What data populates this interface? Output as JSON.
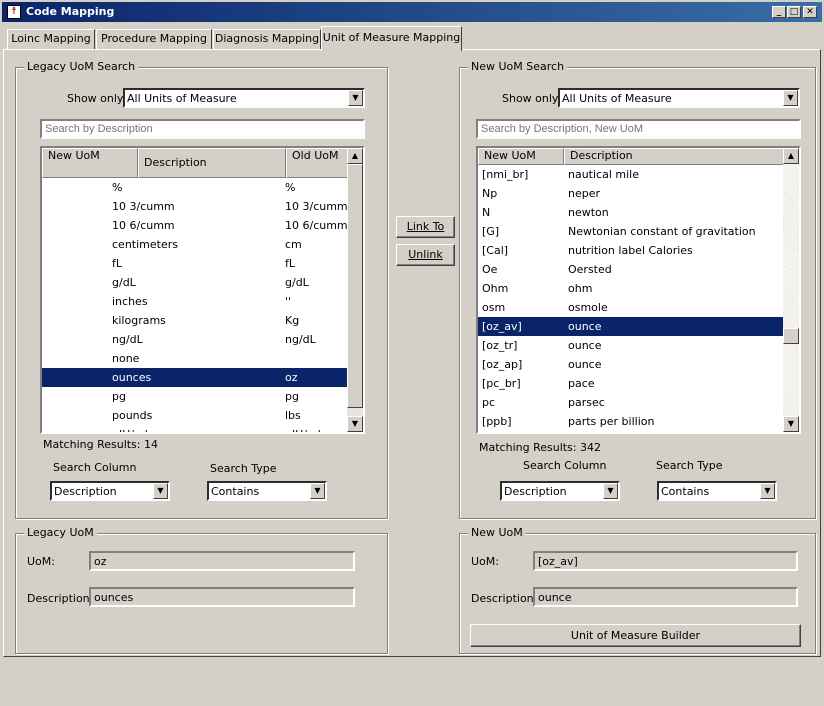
{
  "window": {
    "title": "Code Mapping"
  },
  "tabs": [
    {
      "label": "Loinc Mapping"
    },
    {
      "label": "Procedure  Mapping"
    },
    {
      "label": "Diagnosis Mapping"
    },
    {
      "label": "Unit of Measure Mapping",
      "active": true
    }
  ],
  "legacy_search": {
    "title": "Legacy UoM Search",
    "show_only_label": "Show only:",
    "show_only_value": "All Units of Measure",
    "search_placeholder": "Search by Description",
    "columns": [
      "New UoM",
      "Description",
      "Old UoM"
    ],
    "rows": [
      {
        "new": "",
        "desc": "%",
        "old": "%"
      },
      {
        "new": "",
        "desc": "10 3/cumm",
        "old": "10 3/cumm"
      },
      {
        "new": "",
        "desc": "10 6/cumm",
        "old": "10 6/cumm"
      },
      {
        "new": "",
        "desc": "centimeters",
        "old": "cm"
      },
      {
        "new": "",
        "desc": "fL",
        "old": "fL"
      },
      {
        "new": "",
        "desc": "g/dL",
        "old": "g/dL"
      },
      {
        "new": "",
        "desc": "inches",
        "old": "''"
      },
      {
        "new": "",
        "desc": "kilograms",
        "old": "Kg"
      },
      {
        "new": "",
        "desc": "ng/dL",
        "old": "ng/dL"
      },
      {
        "new": "",
        "desc": "none",
        "old": ""
      },
      {
        "new": "",
        "desc": "ounces",
        "old": "oz",
        "selected": true
      },
      {
        "new": "",
        "desc": "pg",
        "old": "pg"
      },
      {
        "new": "",
        "desc": "pounds",
        "old": "lbs"
      },
      {
        "new": "",
        "desc": "uIU/ml",
        "old": "uIU/ml"
      }
    ],
    "matching_results": "Matching Results: 14",
    "search_column_label": "Search Column",
    "search_column_value": "Description",
    "search_type_label": "Search Type",
    "search_type_value": "Contains"
  },
  "new_search": {
    "title": "New UoM Search",
    "show_only_label": "Show only:",
    "show_only_value": "All Units of Measure",
    "search_placeholder": "Search by Description, New UoM",
    "columns": [
      "New UoM",
      "Description"
    ],
    "rows": [
      {
        "uom": "[nmi_br]",
        "desc": "nautical mile"
      },
      {
        "uom": "Np",
        "desc": "neper"
      },
      {
        "uom": "N",
        "desc": "newton"
      },
      {
        "uom": "[G]",
        "desc": "Newtonian constant of gravitation"
      },
      {
        "uom": "[Cal]",
        "desc": "nutrition label Calories"
      },
      {
        "uom": "Oe",
        "desc": "Oersted"
      },
      {
        "uom": "Ohm",
        "desc": "ohm"
      },
      {
        "uom": "osm",
        "desc": "osmole"
      },
      {
        "uom": "[oz_av]",
        "desc": "ounce",
        "selected": true
      },
      {
        "uom": "[oz_tr]",
        "desc": "ounce"
      },
      {
        "uom": "[oz_ap]",
        "desc": "ounce"
      },
      {
        "uom": "[pc_br]",
        "desc": "pace"
      },
      {
        "uom": "pc",
        "desc": "parsec"
      },
      {
        "uom": "[ppb]",
        "desc": "parts per billion"
      }
    ],
    "matching_results": "Matching Results: 342",
    "search_column_label": "Search Column",
    "search_column_value": "Description",
    "search_type_label": "Search Type",
    "search_type_value": "Contains"
  },
  "actions": {
    "link_to": "Link To",
    "unlink": "Unlink"
  },
  "legacy_uom": {
    "title": "Legacy UoM",
    "uom_label": "UoM:",
    "uom_value": "oz",
    "desc_label": "Description:",
    "desc_value": "ounces"
  },
  "new_uom": {
    "title": "New UoM",
    "uom_label": "UoM:",
    "uom_value": "[oz_av]",
    "desc_label": "Description:",
    "desc_value": "ounce",
    "builder_button": "Unit of Measure Builder"
  }
}
